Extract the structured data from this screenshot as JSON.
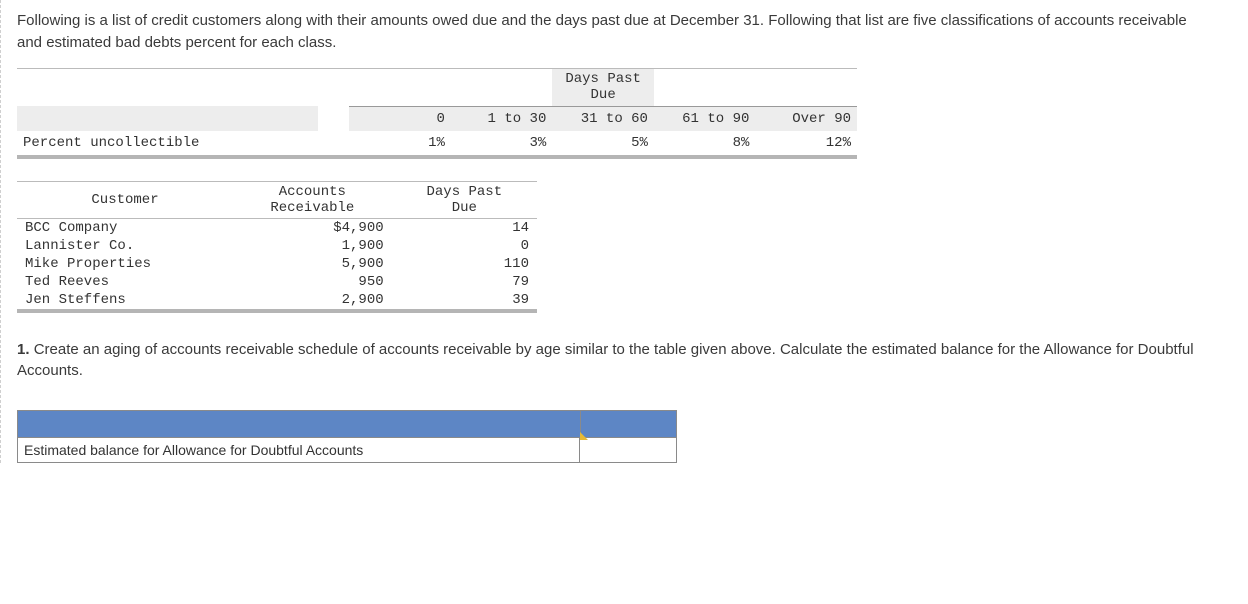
{
  "intro": {
    "p1": "Following is a list of credit customers along with their amounts owed due and the days past due at December 31. Following that list are five classifications of accounts receivable and estimated bad debts percent for each class."
  },
  "percent_table": {
    "group_header": "Days Past Due",
    "row_label": "Percent uncollectible",
    "buckets": [
      "0",
      "1 to 30",
      "31 to 60",
      "61 to 90",
      "Over 90"
    ],
    "percents": [
      "1%",
      "3%",
      "5%",
      "8%",
      "12%"
    ]
  },
  "customer_table": {
    "headers": {
      "customer": "Customer",
      "ar": "Accounts\nReceivable",
      "days": "Days Past\nDue"
    },
    "rows": [
      {
        "name": "BCC Company",
        "ar": "$4,900",
        "days": "14"
      },
      {
        "name": "Lannister Co.",
        "ar": "1,900",
        "days": "0"
      },
      {
        "name": "Mike Properties",
        "ar": "5,900",
        "days": "110"
      },
      {
        "name": "Ted Reeves",
        "ar": "950",
        "days": "79"
      },
      {
        "name": "Jen Steffens",
        "ar": "2,900",
        "days": "39"
      }
    ]
  },
  "question": {
    "number": "1.",
    "text": "Create an aging of accounts receivable schedule of accounts receivable by age similar to the table given above. Calculate the estimated balance for the Allowance for Doubtful Accounts."
  },
  "answer_box": {
    "label": "Estimated balance for Allowance for Doubtful Accounts",
    "value": ""
  },
  "chart_data": [
    {
      "type": "table",
      "title": "Percent uncollectible by days past due",
      "categories": [
        "0",
        "1 to 30",
        "31 to 60",
        "61 to 90",
        "Over 90"
      ],
      "values": [
        1,
        3,
        5,
        8,
        12
      ],
      "unit": "%"
    },
    {
      "type": "table",
      "title": "Customer accounts receivable aging",
      "columns": [
        "Customer",
        "Accounts Receivable",
        "Days Past Due"
      ],
      "rows": [
        [
          "BCC Company",
          4900,
          14
        ],
        [
          "Lannister Co.",
          1900,
          0
        ],
        [
          "Mike Properties",
          5900,
          110
        ],
        [
          "Ted Reeves",
          950,
          79
        ],
        [
          "Jen Steffens",
          2900,
          39
        ]
      ]
    }
  ]
}
